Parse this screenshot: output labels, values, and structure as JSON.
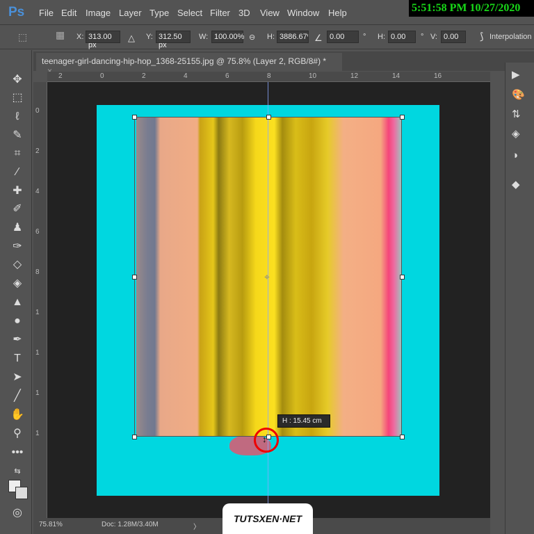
{
  "app": {
    "logo": "Ps",
    "clock": "5:51:58 PM 10/27/2020"
  },
  "menu": [
    "File",
    "Edit",
    "Image",
    "Layer",
    "Type",
    "Select",
    "Filter",
    "3D",
    "View",
    "Window",
    "Help"
  ],
  "options": {
    "x_label": "X:",
    "x": "313.00 px",
    "y_label": "Y:",
    "y": "312.50 px",
    "w_label": "W:",
    "w": "100.00%",
    "h_label": "H:",
    "h": "3886.67%",
    "angle": "0.00",
    "hskew_label": "H:",
    "hskew": "0.00",
    "vskew_label": "V:",
    "vskew": "0.00",
    "interpolation": "Interpolation"
  },
  "document": {
    "tab_title": "teenager-girl-dancing-hip-hop_1368-25155.jpg @ 75.8% (Layer 2, RGB/8#) *",
    "close": "×"
  },
  "ruler_top": [
    "2",
    "0",
    "2",
    "4",
    "6",
    "8",
    "10",
    "12",
    "14",
    "16"
  ],
  "ruler_left": [
    "0",
    "2",
    "4",
    "6",
    "8",
    "1",
    "1",
    "1",
    "1"
  ],
  "tooltip": "H :   15.45 cm",
  "status": {
    "zoom": "75.81%",
    "doc": "Doc: 1.28M/3.40M",
    "arrow": "〉"
  },
  "watermark": "TUTSXEN·NET",
  "tools": [
    "move",
    "marquee",
    "lasso",
    "quick-select",
    "crop",
    "eyedropper",
    "healing",
    "brush",
    "stamp",
    "history-brush",
    "eraser",
    "paint-bucket",
    "blur",
    "dodge",
    "pen",
    "type",
    "path-select",
    "line",
    "hand",
    "zoom",
    "more",
    "swap-colors",
    "colors",
    "quick-mask"
  ],
  "colors": {
    "canvas_bg": "#00d7e0",
    "highlight": "#e00000",
    "clock": "#18d818"
  }
}
